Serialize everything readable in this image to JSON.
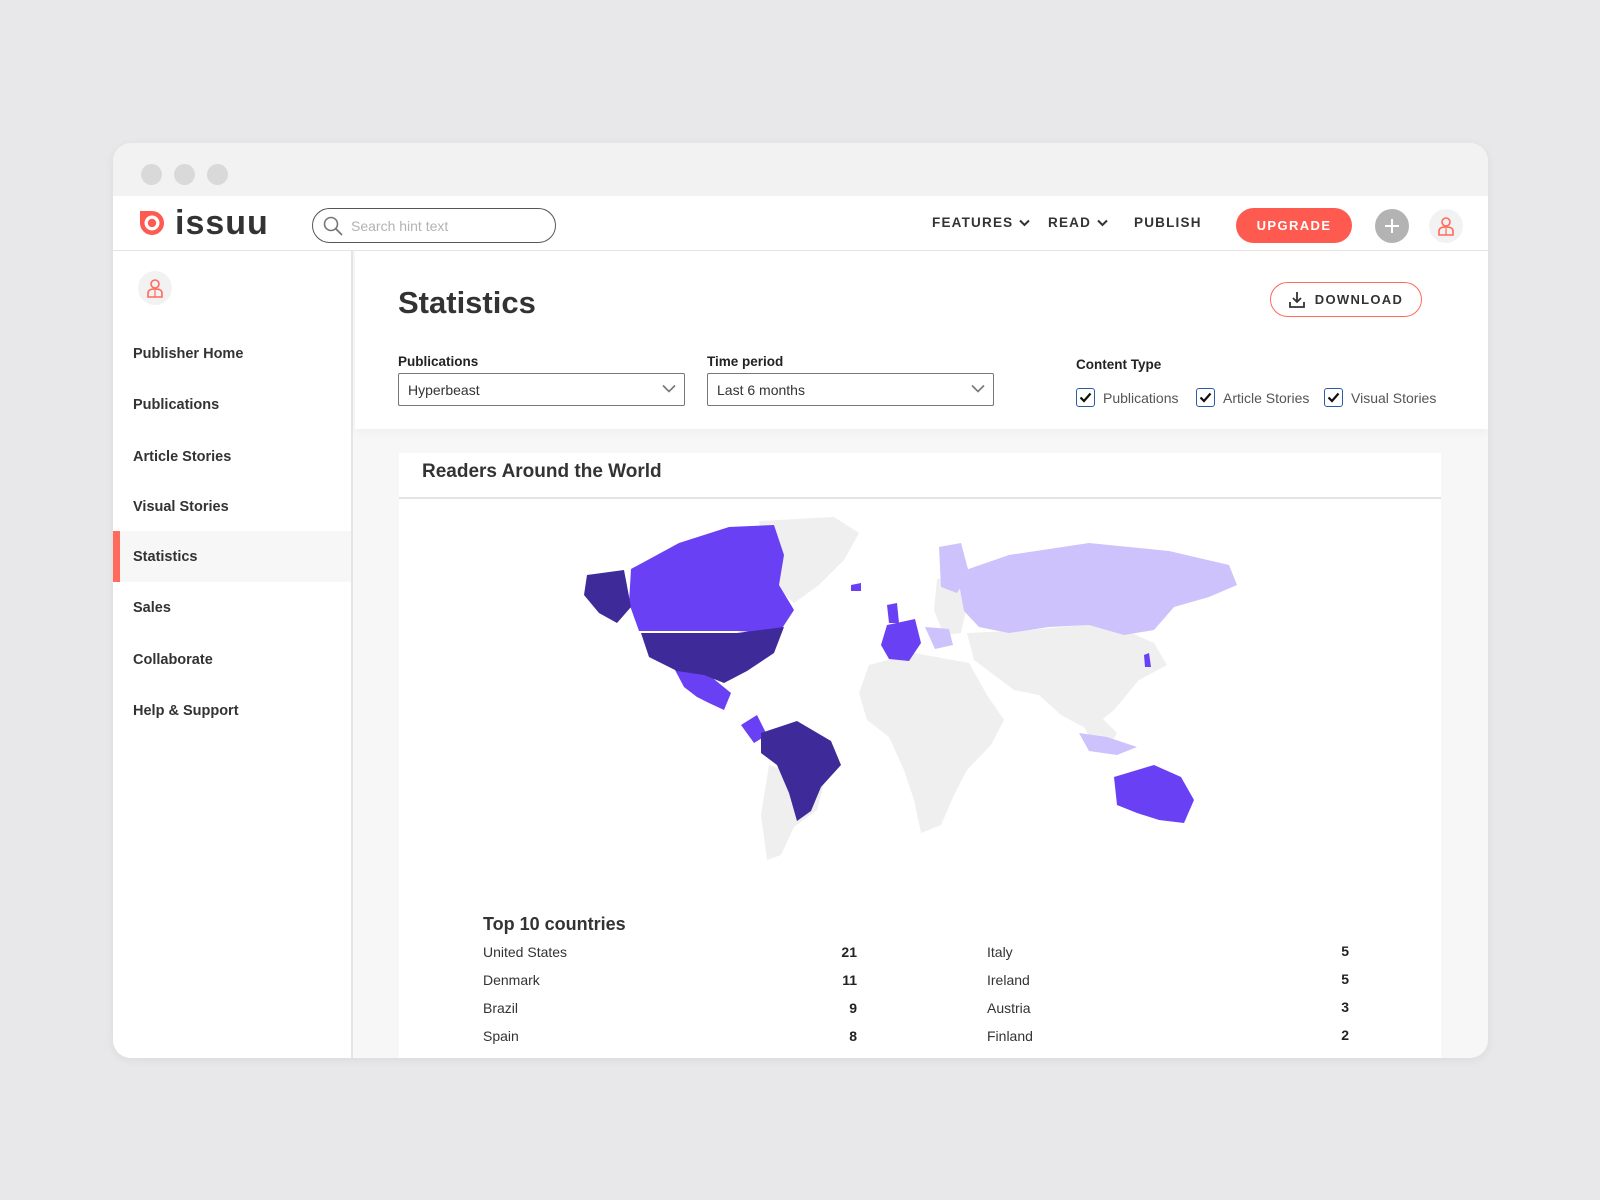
{
  "app": {
    "logo_text": "issuu",
    "colors": {
      "accent": "#ff5a4f",
      "map_high": "#3f2a99",
      "map_mid": "#6a40f5",
      "map_low": "#cdc2fb",
      "map_none": "#efefef"
    }
  },
  "topnav": {
    "search": {
      "placeholder": "Search hint text",
      "icon": "search-icon"
    },
    "links": [
      {
        "label": "FEATURES",
        "has_dropdown": true
      },
      {
        "label": "READ",
        "has_dropdown": true
      },
      {
        "label": "PUBLISH",
        "has_dropdown": false
      }
    ],
    "upgrade_label": "UPGRADE",
    "add_icon": "plus-icon",
    "user_icon": "user-icon"
  },
  "sidebar": {
    "items": [
      {
        "label": "Publisher Home",
        "active": false
      },
      {
        "label": "Publications",
        "active": false
      },
      {
        "label": "Article Stories",
        "active": false
      },
      {
        "label": "Visual Stories",
        "active": false
      },
      {
        "label": "Statistics",
        "active": true
      },
      {
        "label": "Sales",
        "active": false
      },
      {
        "label": "Collaborate",
        "active": false
      },
      {
        "label": "Help & Support",
        "active": false
      }
    ]
  },
  "main": {
    "title": "Statistics",
    "download_label": "DOWNLOAD",
    "filters": {
      "publications": {
        "label": "Publications",
        "value": "Hyperbeast"
      },
      "time_period": {
        "label": "Time period",
        "value": "Last 6 months"
      },
      "content_type": {
        "label": "Content Type",
        "options": [
          {
            "label": "Publications",
            "checked": true
          },
          {
            "label": "Article Stories",
            "checked": true
          },
          {
            "label": "Visual Stories",
            "checked": true
          }
        ]
      }
    },
    "map_card": {
      "title": "Readers Around the World",
      "top_title": "Top 10 countries",
      "top_countries": [
        {
          "name": "United States",
          "value": "21"
        },
        {
          "name": "Denmark",
          "value": "11"
        },
        {
          "name": "Brazil",
          "value": "9"
        },
        {
          "name": "Spain",
          "value": "8"
        },
        {
          "name": "Italy",
          "value": "5"
        },
        {
          "name": "Ireland",
          "value": "5"
        },
        {
          "name": "Austria",
          "value": "3"
        },
        {
          "name": "Finland",
          "value": "2"
        }
      ]
    }
  }
}
